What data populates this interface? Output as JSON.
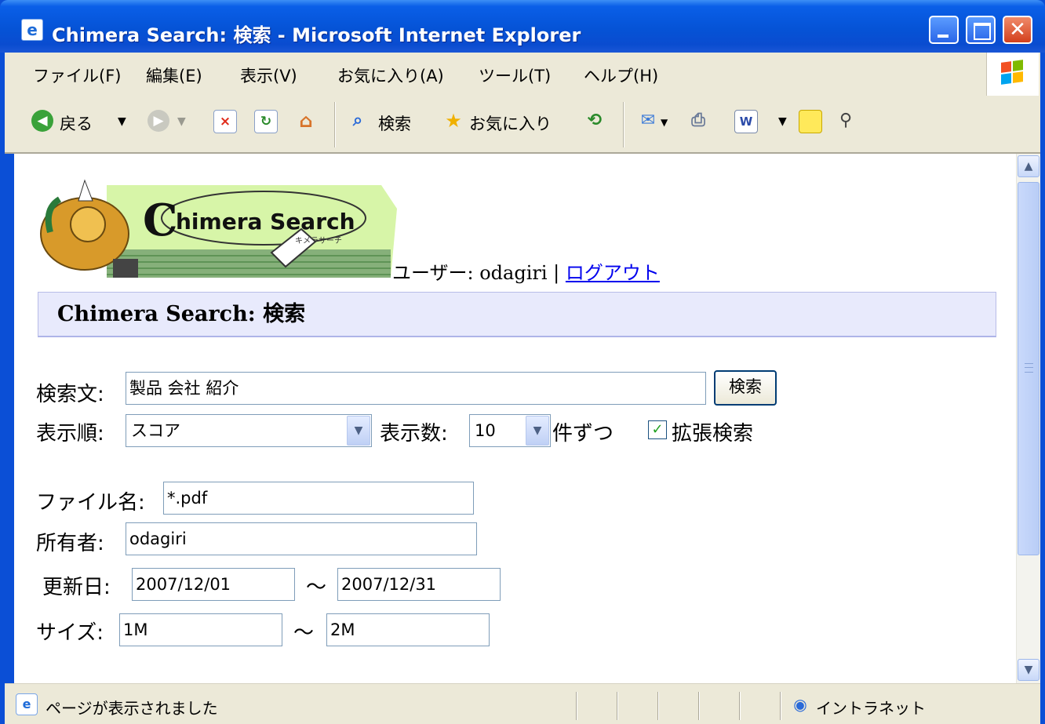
{
  "window": {
    "title": "Chimera Search: 検索 - Microsoft Internet Explorer"
  },
  "menu": [
    "ファイル(F)",
    "編集(E)",
    "表示(V)",
    "お気に入り(A)",
    "ツール(T)",
    "ヘルプ(H)"
  ],
  "toolbar": {
    "back_label": "戻る",
    "search_label": "検索",
    "favorites_label": "お気に入り"
  },
  "logo": {
    "text": "himera Search",
    "initial": "C",
    "sub": "キメラサーチ"
  },
  "user": {
    "label": "ユーザー: odagiri | ",
    "logout": "ログアウト"
  },
  "page_title": "Chimera Search: 検索",
  "form": {
    "query_label": "検索文:",
    "query_value": "製品 会社 紹介",
    "search_button": "検索",
    "order_label": "表示順:",
    "order_value": "スコア",
    "count_label": "表示数:",
    "count_value": "10",
    "count_suffix": "件ずつ",
    "extended_label": "拡張検索",
    "filename_label": "ファイル名:",
    "filename_value": "*.pdf",
    "owner_label": "所有者:",
    "owner_value": "odagiri",
    "updated_label": "更新日:",
    "updated_from": "2007/12/01",
    "updated_to": "2007/12/31",
    "size_label": "サイズ:",
    "size_from": "1M",
    "size_to": "2M",
    "range_sep": "～"
  },
  "status": {
    "text": "ページが表示されました",
    "zone": "イントラネット"
  },
  "colors": {
    "titlebar": "#0553d6",
    "chrome": "#ece9d8",
    "heading_bg": "#e8eafc",
    "link": "#0000ee"
  }
}
